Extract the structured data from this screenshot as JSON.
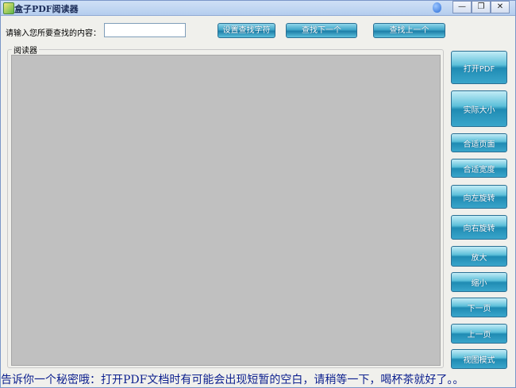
{
  "window": {
    "title": "盒子PDF阅读器",
    "controls": {
      "minimize": "—",
      "restore": "❐",
      "close": "✕"
    }
  },
  "search": {
    "label": "请输入您所要查找的内容：",
    "value": "",
    "buttons": {
      "set_search": "设置查找字符",
      "find_next": "查找下一个",
      "find_prev": "查找上一个"
    }
  },
  "reader": {
    "legend": "阅读器"
  },
  "sidebar": {
    "items": [
      {
        "label": "打开PDF"
      },
      {
        "label": "实际大小"
      },
      {
        "label": "合适页面"
      },
      {
        "label": "合适宽度"
      },
      {
        "label": "向左旋转"
      },
      {
        "label": "向右旋转"
      },
      {
        "label": "放大"
      },
      {
        "label": "缩小"
      },
      {
        "label": "下一页"
      },
      {
        "label": "上一页"
      },
      {
        "label": "视图模式"
      }
    ]
  },
  "status": {
    "message": "告诉你一个秘密哦：打开PDF文档时有可能会出现短暂的空白，请稍等一下，喝杯茶就好了。。"
  },
  "colors": {
    "reader_bg": "#c0c0c0",
    "button_blue": "#1f8bb3",
    "status_text": "#0c1f8e"
  }
}
